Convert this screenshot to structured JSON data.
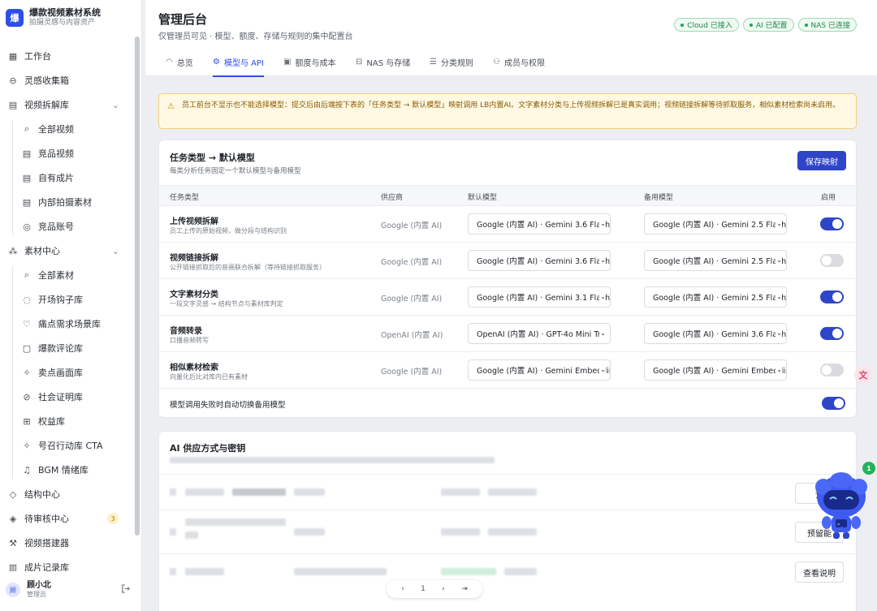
{
  "brand": {
    "logo_char": "爆",
    "name": "爆款视频素材系统",
    "subtitle": "拍摄灵感与内容资产"
  },
  "sidebar": {
    "items": [
      {
        "label": "工作台",
        "icon": "grid-icon"
      },
      {
        "label": "灵感收集箱",
        "icon": "inbox-icon"
      },
      {
        "label": "视频拆解库",
        "icon": "film-icon",
        "expanded": true
      },
      {
        "label": "全部视频",
        "icon": "search-icon",
        "sub": true
      },
      {
        "label": "竞品视频",
        "icon": "film-icon",
        "sub": true
      },
      {
        "label": "自有成片",
        "icon": "film-icon",
        "sub": true
      },
      {
        "label": "内部拍摄素材",
        "icon": "film-icon",
        "sub": true
      },
      {
        "label": "竞品账号",
        "icon": "target-icon",
        "sub": true
      },
      {
        "label": "素材中心",
        "icon": "cluster-icon",
        "expanded": true
      },
      {
        "label": "全部素材",
        "icon": "search-icon",
        "sub": true
      },
      {
        "label": "开场钩子库",
        "icon": "hook-icon",
        "sub": true
      },
      {
        "label": "痛点需求场景库",
        "icon": "heart-icon",
        "sub": true
      },
      {
        "label": "爆款评论库",
        "icon": "comment-icon",
        "sub": true
      },
      {
        "label": "卖点画面库",
        "icon": "sparkle-icon",
        "sub": true
      },
      {
        "label": "社会证明库",
        "icon": "check-circle-icon",
        "sub": true
      },
      {
        "label": "权益库",
        "icon": "gift-icon",
        "sub": true
      },
      {
        "label": "号召行动库 CTA",
        "icon": "sparkle-icon",
        "sub": true
      },
      {
        "label": "BGM 情绪库",
        "icon": "music-icon",
        "sub": true
      },
      {
        "label": "结构中心",
        "icon": "layers-icon"
      },
      {
        "label": "待审核中心",
        "icon": "shield-icon",
        "badge": "3"
      },
      {
        "label": "视频搭建器",
        "icon": "wrench-icon"
      },
      {
        "label": "成片记录库",
        "icon": "clipboard-icon"
      }
    ]
  },
  "user": {
    "avatar": "顾",
    "name": "顾小北",
    "role": "管理员"
  },
  "header": {
    "title": "管理后台",
    "subtitle": "仅管理员可见 · 模型、额度、存储与规则的集中配置台",
    "status": [
      "Cloud 已接入",
      "AI 已配置",
      "NAS 已连接"
    ],
    "status_color": "#1d8a47"
  },
  "tabs": [
    {
      "label": "总览",
      "icon": "gauge-icon"
    },
    {
      "label": "模型与 API",
      "icon": "chip-icon",
      "active": true
    },
    {
      "label": "额度与成本",
      "icon": "wallet-icon"
    },
    {
      "label": "NAS 与存储",
      "icon": "drive-icon"
    },
    {
      "label": "分类规则",
      "icon": "rules-icon"
    },
    {
      "label": "成员与权限",
      "icon": "users-icon"
    }
  ],
  "notice": "员工前台不显示也不能选择模型：提交后由后端按下表的「任务类型 → 默认模型」映射调用 LB内置AI。文字素材分类与上传视频拆解已是真实调用；视频链接拆解等待抓取服务，相似素材检索尚未启用。",
  "mapping": {
    "title": "任务类型 → 默认模型",
    "subtitle": "每类分析任务固定一个默认模型与备用模型",
    "save_label": "保存映射",
    "columns": [
      "任务类型",
      "供应商",
      "默认模型",
      "备用模型",
      "启用"
    ],
    "rows": [
      {
        "name": "上传视频拆解",
        "desc": "员工上传的原始视频，做分段与结构识别",
        "provider": "Google (内置 AI)",
        "default_model": "Google (内置 AI) · Gemini 3.6 Flash",
        "backup_model": "Google (内置 AI) · Gemini 2.5 Flash",
        "enabled": true
      },
      {
        "name": "视频链接拆解",
        "desc": "公开链接抓取后的音画联合拆解（等待链接抓取服务）",
        "provider": "Google (内置 AI)",
        "default_model": "Google (内置 AI) · Gemini 3.6 Flash",
        "backup_model": "Google (内置 AI) · Gemini 2.5 Flash",
        "enabled": false
      },
      {
        "name": "文字素材分类",
        "desc": "一段文字灵感 → 结构节点与素材库判定",
        "provider": "Google (内置 AI)",
        "default_model": "Google (内置 AI) · Gemini 3.1 Flash",
        "backup_model": "Google (内置 AI) · Gemini 2.5 Flash",
        "enabled": true
      },
      {
        "name": "音频转录",
        "desc": "口播音频转写",
        "provider": "OpenAI (内置 AI)",
        "default_model": "OpenAI (内置 AI) · GPT-4o Mini Tr",
        "backup_model": "Google (内置 AI) · Gemini 3.6 Flash",
        "enabled": true
      },
      {
        "name": "相似素材检索",
        "desc": "向量化后比对库内已有素材",
        "provider": "Google (内置 AI)",
        "default_model": "Google (内置 AI) · Gemini Embedding",
        "backup_model": "Google (内置 AI) · Gemini Embedding",
        "enabled": false
      }
    ],
    "fallback_label": "模型调用失败时自动切换备用模型",
    "fallback_enabled": true
  },
  "providers": {
    "title": "AI 供应方式与密钥",
    "btn_labels": [
      "预",
      "预留能",
      "查看说明"
    ]
  },
  "pager": {
    "items": [
      "‹",
      "1",
      "›",
      "⇥"
    ]
  },
  "floating": {
    "translate_icon": "文",
    "bot_badge": "1"
  }
}
